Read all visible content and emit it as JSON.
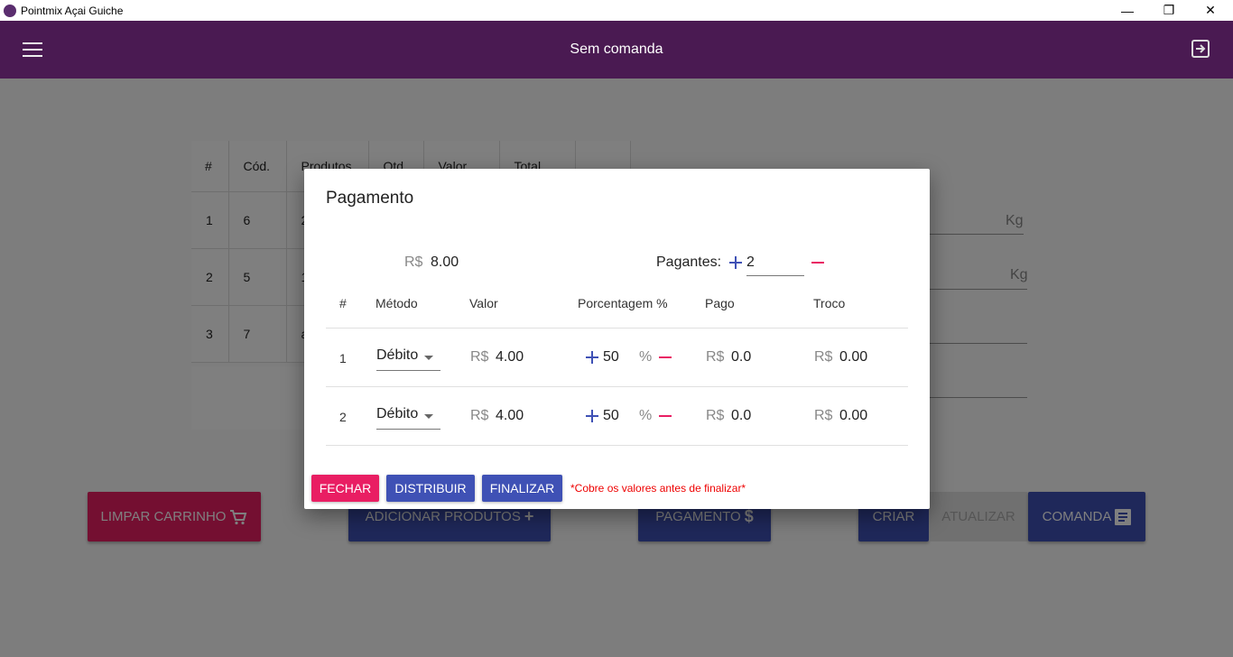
{
  "window": {
    "title": "Pointmix Açai Guiche",
    "minimize": "—",
    "restore": "❐",
    "close": "✕"
  },
  "appbar": {
    "title": "Sem comanda",
    "menu_icon": "hamburger-menu-icon",
    "exit_icon": "exit-icon",
    "bg_color": "#4a1a52"
  },
  "products_table": {
    "headers": [
      "#",
      "Cód.",
      "Produtos",
      "Qtd",
      "Valor",
      "Total",
      ""
    ],
    "rows": [
      {
        "n": "1",
        "cod": "6",
        "prod": "2"
      },
      {
        "n": "2",
        "cod": "5",
        "prod": "1"
      },
      {
        "n": "3",
        "cod": "7",
        "prod": "a"
      }
    ]
  },
  "side_fields": {
    "unit1": "Kg",
    "unit2": "Kg"
  },
  "actions": {
    "limpar": "LIMPAR CARRINHO",
    "adicionar": "ADICIONAR PRODUTOS",
    "pagamento": "PAGAMENTO",
    "criar": "CRIAR",
    "atualizar": "ATUALIZAR",
    "comanda": "COMANDA"
  },
  "dialog": {
    "title": "Pagamento",
    "currency": "R$",
    "total": "8.00",
    "payers_label": "Pagantes:",
    "payers": "2",
    "headers": {
      "n": "#",
      "method": "Método",
      "value": "Valor",
      "percent": "Porcentagem %",
      "paid": "Pago",
      "change": "Troco"
    },
    "rows": [
      {
        "n": "1",
        "method": "Débito",
        "value": "4.00",
        "percent": "50",
        "pct_sign": "%",
        "paid": "0.0",
        "change": "0.00"
      },
      {
        "n": "2",
        "method": "Débito",
        "value": "4.00",
        "percent": "50",
        "pct_sign": "%",
        "paid": "0.0",
        "change": "0.00"
      }
    ],
    "buttons": {
      "fechar": "FECHAR",
      "distribuir": "DISTRIBUIR",
      "finalizar": "FINALIZAR"
    },
    "warning": "*Cobre os valores antes de finalizar*"
  },
  "colors": {
    "primary": "#3f51b5",
    "accent": "#e91e63",
    "danger_bg": "#c2185b",
    "warning_text": "#e00000"
  }
}
